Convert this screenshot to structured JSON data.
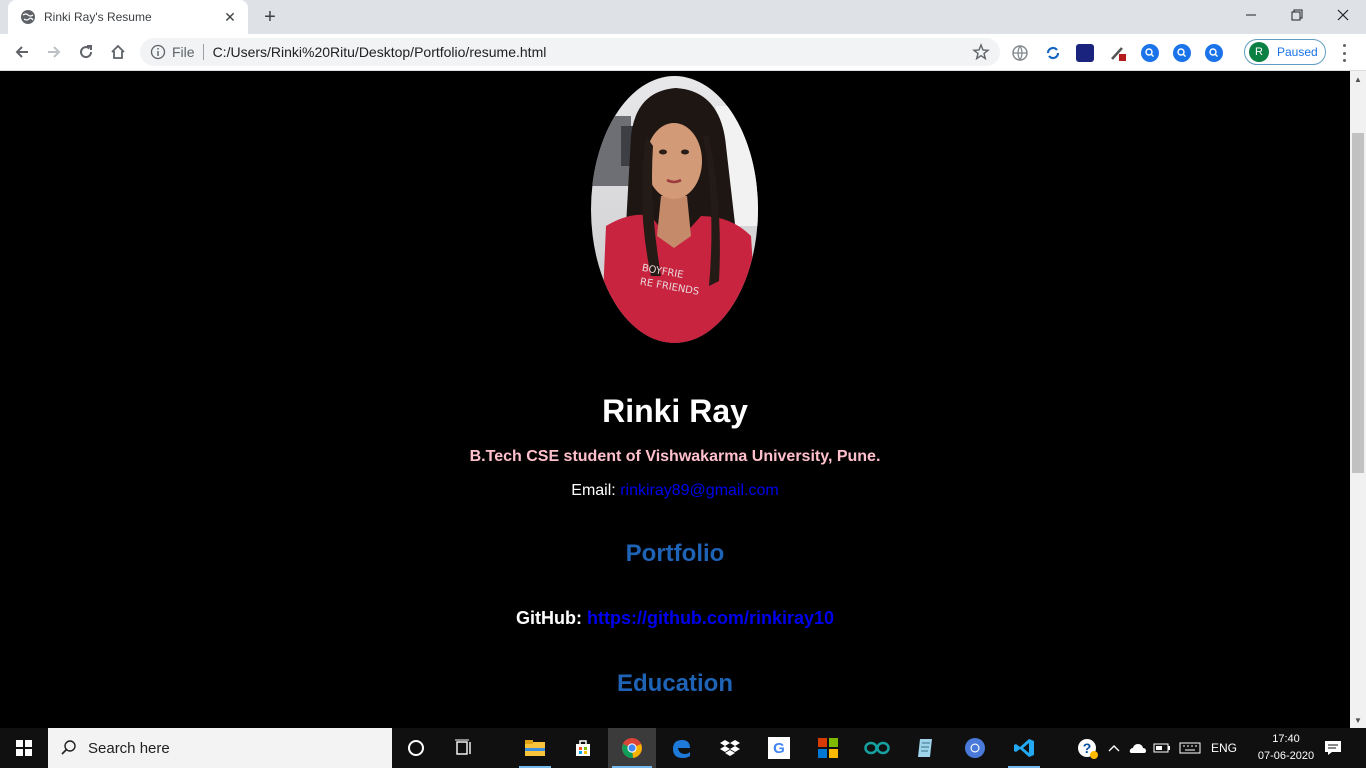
{
  "browser": {
    "tab_title": "Rinki Ray's Resume",
    "tab_close": "✕",
    "new_tab": "+",
    "omnibox": {
      "scheme_label": "File",
      "url": "C:/Users/Rinki%20Ritu/Desktop/Portfolio/resume.html"
    },
    "profile": {
      "initial": "R",
      "status": "Paused"
    },
    "extension_icons": [
      "globe-icon",
      "sync-icon",
      "extension-dark-icon",
      "extension-pen-icon",
      "search-extension-icon",
      "search-extension-icon",
      "search-extension-icon"
    ]
  },
  "page": {
    "name": "Rinki Ray",
    "subtitle": "B.Tech CSE student of Vishwakarma University, Pune.",
    "email_label": "Email:",
    "email": "rinkiray89@gmail.com",
    "portfolio_heading": "Portfolio",
    "github_label": "GitHub:",
    "github_url": "https://github.com/rinkiray10",
    "education_heading": "Education"
  },
  "taskbar": {
    "search_placeholder": "Search here",
    "language": "ENG",
    "time": "17:40",
    "date": "07-06-2020",
    "pinned_apps": [
      "cortana-icon",
      "task-view-icon",
      "file-explorer-icon",
      "store-icon",
      "chrome-icon",
      "edge-icon",
      "dropbox-icon",
      "google-icon",
      "office-icon",
      "arduino-icon",
      "notepad-icon",
      "chromium-icon",
      "vscode-icon"
    ]
  },
  "colors": {
    "page_bg": "#000000",
    "subtitle": "#ffc0cb",
    "heading": "#1e63b5",
    "link": "#0000ee"
  }
}
